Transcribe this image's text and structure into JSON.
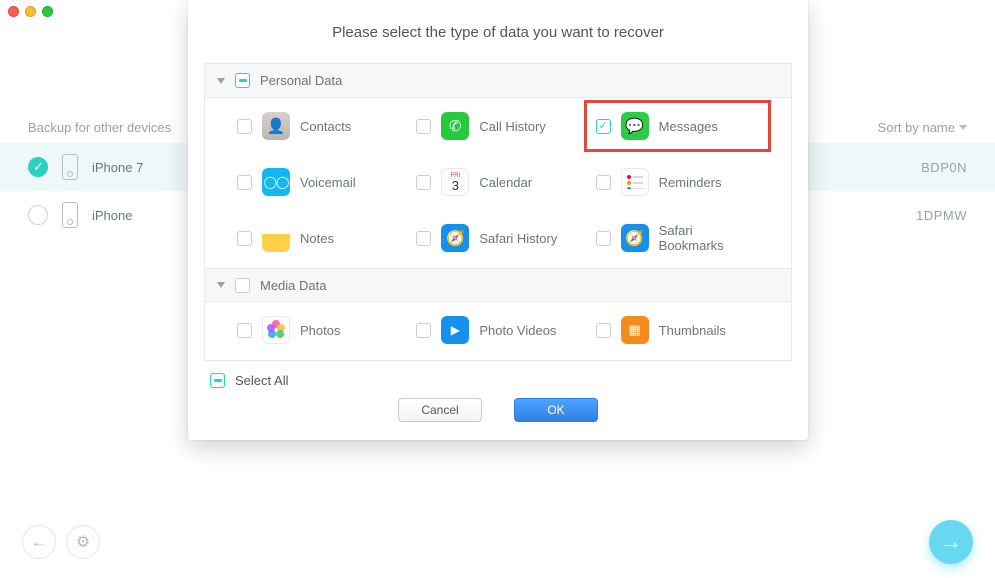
{
  "backup_header": "Backup for other devices",
  "sort_label": "Sort by name",
  "devices": [
    {
      "name": "iPhone 7",
      "id_suffix": "BDP0N",
      "selected": true
    },
    {
      "name": "iPhone",
      "id_suffix": "1DPMW",
      "selected": false
    }
  ],
  "modal": {
    "title": "Please select the type of data you want to recover",
    "sections": [
      {
        "key": "personal",
        "title": "Personal Data",
        "state": "indeterminate",
        "items": [
          {
            "key": "contacts",
            "label": "Contacts",
            "checked": false,
            "highlight": false
          },
          {
            "key": "call_history",
            "label": "Call History",
            "checked": false,
            "highlight": false
          },
          {
            "key": "messages",
            "label": "Messages",
            "checked": true,
            "highlight": true
          },
          {
            "key": "voicemail",
            "label": "Voicemail",
            "checked": false,
            "highlight": false
          },
          {
            "key": "calendar",
            "label": "Calendar",
            "checked": false,
            "highlight": false
          },
          {
            "key": "reminders",
            "label": "Reminders",
            "checked": false,
            "highlight": false
          },
          {
            "key": "notes",
            "label": "Notes",
            "checked": false,
            "highlight": false
          },
          {
            "key": "safari_history",
            "label": "Safari History",
            "checked": false,
            "highlight": false
          },
          {
            "key": "safari_bookmarks",
            "label": "Safari Bookmarks",
            "checked": false,
            "highlight": false
          }
        ]
      },
      {
        "key": "media",
        "title": "Media Data",
        "state": "unchecked",
        "items": [
          {
            "key": "photos",
            "label": "Photos",
            "checked": false,
            "highlight": false
          },
          {
            "key": "photo_videos",
            "label": "Photo Videos",
            "checked": false,
            "highlight": false
          },
          {
            "key": "thumbnails",
            "label": "Thumbnails",
            "checked": false,
            "highlight": false
          }
        ]
      }
    ],
    "select_all": {
      "label": "Select All",
      "state": "indeterminate"
    },
    "buttons": {
      "cancel": "Cancel",
      "ok": "OK"
    },
    "calendar_icon": {
      "top": "FRI",
      "day": "3"
    }
  }
}
